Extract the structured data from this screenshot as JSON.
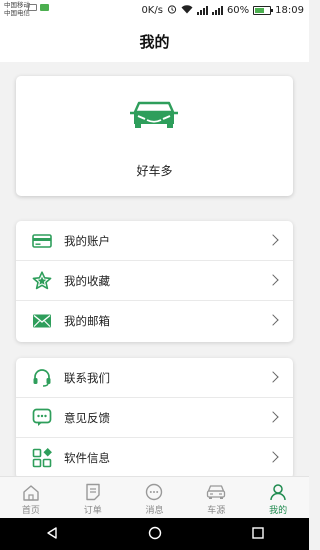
{
  "status_bar": {
    "carrier_1": "中国移动",
    "carrier_2": "中国电信",
    "network_speed": "0K/s",
    "battery_percent": "60%",
    "battery_level": 0.6,
    "time": "18:09"
  },
  "header": {
    "title": "我的"
  },
  "profile": {
    "name": "好车多",
    "logo_icon": "car-front-icon"
  },
  "menu_group_1": [
    {
      "label": "我的账户",
      "icon": "card-icon"
    },
    {
      "label": "我的收藏",
      "icon": "star-icon"
    },
    {
      "label": "我的邮箱",
      "icon": "mail-icon"
    }
  ],
  "menu_group_2": [
    {
      "label": "联系我们",
      "icon": "headset-icon"
    },
    {
      "label": "意见反馈",
      "icon": "feedback-icon"
    },
    {
      "label": "软件信息",
      "icon": "apps-icon"
    }
  ],
  "tabs": [
    {
      "label": "首页",
      "icon": "home-icon"
    },
    {
      "label": "订单",
      "icon": "order-icon"
    },
    {
      "label": "消息",
      "icon": "message-icon"
    },
    {
      "label": "车源",
      "icon": "car-icon"
    },
    {
      "label": "我的",
      "icon": "user-icon",
      "active": true
    }
  ],
  "colors": {
    "accent": "#1e8a4e",
    "icon_green": "#2e9e5b",
    "inactive": "#888888"
  }
}
